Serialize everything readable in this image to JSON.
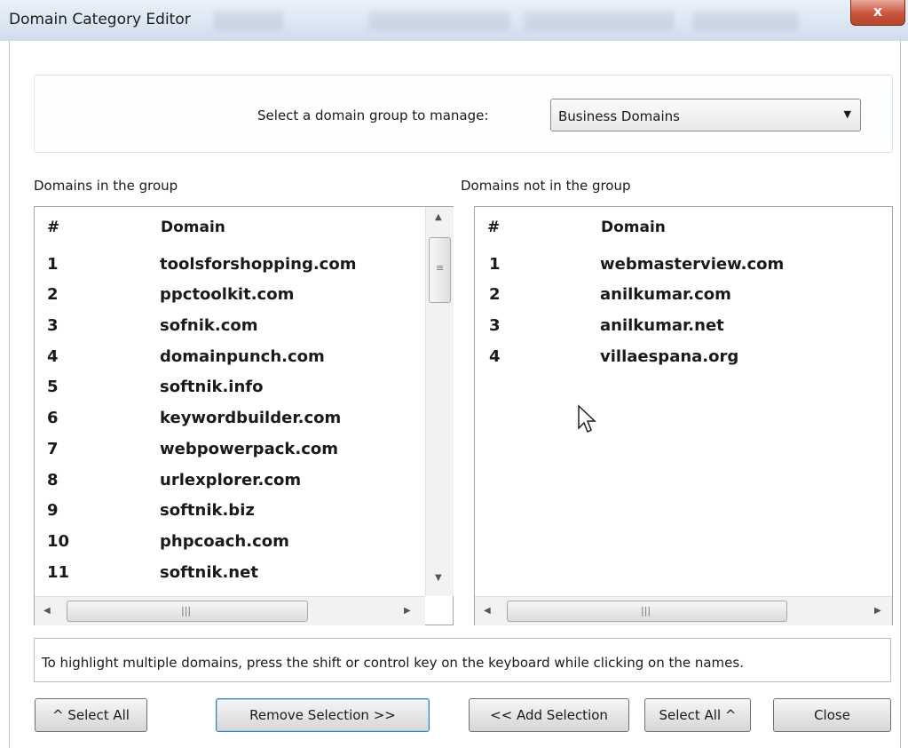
{
  "window": {
    "title": "Domain Category Editor",
    "close_glyph": "x"
  },
  "group_selector": {
    "label": "Select a domain group to manage:",
    "selected": "Business Domains"
  },
  "in_group": {
    "label": "Domains in the group",
    "columns": [
      "#",
      "Domain"
    ],
    "rows": [
      {
        "num": "1",
        "domain": "toolsforshopping.com"
      },
      {
        "num": "2",
        "domain": "ppctoolkit.com"
      },
      {
        "num": "3",
        "domain": "sofnik.com"
      },
      {
        "num": "4",
        "domain": "domainpunch.com"
      },
      {
        "num": "5",
        "domain": "softnik.info"
      },
      {
        "num": "6",
        "domain": "keywordbuilder.com"
      },
      {
        "num": "7",
        "domain": "webpowerpack.com"
      },
      {
        "num": "8",
        "domain": "urlexplorer.com"
      },
      {
        "num": "9",
        "domain": "softnik.biz"
      },
      {
        "num": "10",
        "domain": "phpcoach.com"
      },
      {
        "num": "11",
        "domain": "softnik.net"
      }
    ]
  },
  "not_in_group": {
    "label": "Domains not in the group",
    "columns": [
      "#",
      "Domain"
    ],
    "rows": [
      {
        "num": "1",
        "domain": "webmasterview.com"
      },
      {
        "num": "2",
        "domain": "anilkumar.com"
      },
      {
        "num": "3",
        "domain": "anilkumar.net"
      },
      {
        "num": "4",
        "domain": "villaespana.org"
      }
    ]
  },
  "hint": "To highlight multiple domains, press the shift or control key on the keyboard while clicking on the names.",
  "buttons": {
    "select_all_left": "^ Select All",
    "remove_selection": "Remove Selection >>",
    "add_selection": "<< Add Selection",
    "select_all_right": "Select All ^",
    "close": "Close"
  }
}
